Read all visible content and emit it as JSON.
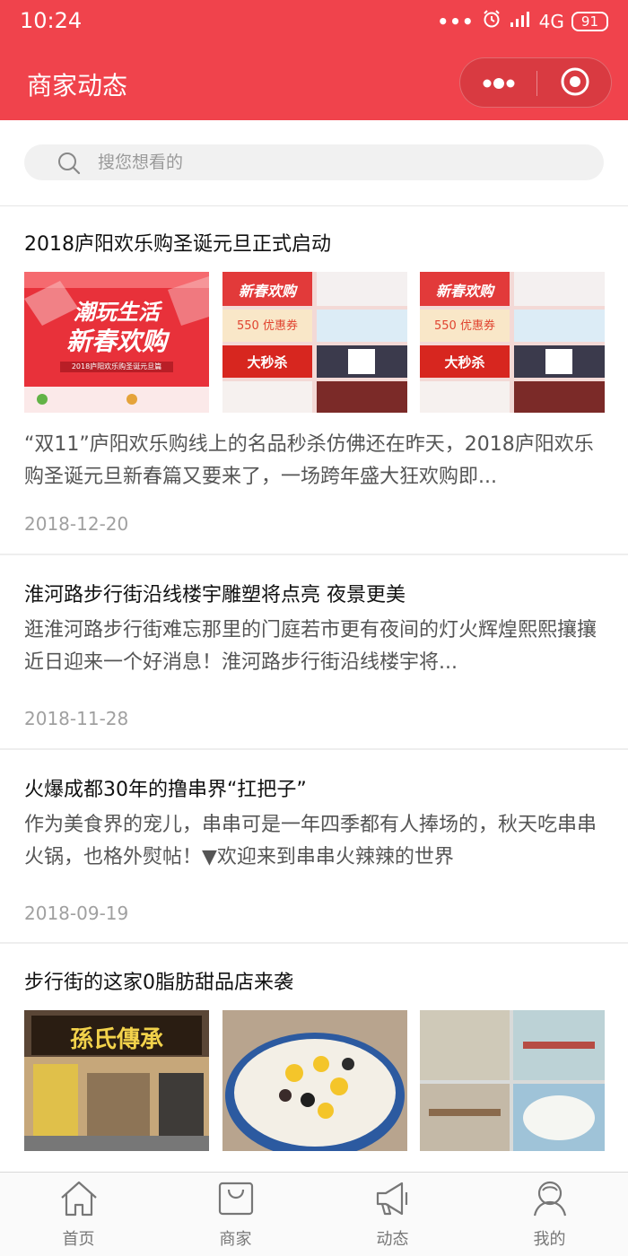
{
  "status_bar": {
    "time": "10:24",
    "signal_dots": "•••",
    "network": "4G",
    "battery": "91"
  },
  "navbar": {
    "title": "商家动态",
    "more_icon": "more-dots-icon",
    "close_icon": "record-circle-icon",
    "background": "#f0434c"
  },
  "search": {
    "placeholder": "搜您想看的",
    "icon": "search-icon"
  },
  "feed": [
    {
      "title": "2018庐阳欢乐购圣诞元旦正式启动",
      "summary": "“双11”庐阳欢乐购线上的名品秒杀仿佛还在昨天，2018庐阳欢乐购圣诞元旦新春篇又要来了，一场跨年盛大狂欢购即...",
      "date": "2018-12-20",
      "images": [
        {
          "caption_line1": "潮玩生活",
          "caption_line2": "新春欢购",
          "promo_top": "2018庐阳欢乐购圣诞元旦篇"
        },
        {
          "headline": "新春欢购",
          "coupon": "550 优惠券",
          "sale": "大秒杀"
        },
        {
          "headline": "新春欢购",
          "coupon": "550 优惠券",
          "sale": "大秒杀"
        }
      ]
    },
    {
      "title": "淮河路步行街沿线楼宇雕塑将点亮 夜景更美",
      "summary": "逛淮河路步行街难忘那里的门庭若市更有夜间的灯火辉煌熙熙攘攘近日迎来一个好消息！淮河路步行街沿线楼宇将...",
      "date": "2018-11-28"
    },
    {
      "title": "火爆成都30年的撸串界“扛把子”",
      "summary": "作为美食界的宠儿，串串可是一年四季都有人捧场的，秋天吃串串火锅，也格外熨帖！▼欢迎来到串串火辣辣的世界",
      "date": "2018-09-19"
    },
    {
      "title": "步行街的这家0脂肪甜品店来袭",
      "images": [
        {
          "sign": "孫氏傳承"
        },
        {
          "desc": "dessert-bowl"
        },
        {
          "desc": "shop-interior"
        }
      ]
    }
  ],
  "tabbar": [
    {
      "label": "首页",
      "icon": "home-icon"
    },
    {
      "label": "商家",
      "icon": "shopping-bag-icon"
    },
    {
      "label": "动态",
      "icon": "megaphone-icon"
    },
    {
      "label": "我的",
      "icon": "user-icon"
    }
  ]
}
